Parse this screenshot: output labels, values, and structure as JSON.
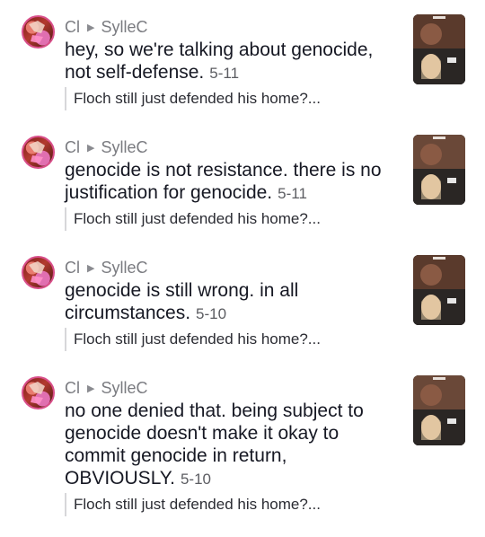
{
  "comments": [
    {
      "user": "Cl",
      "reply_to": "SylleC",
      "text": "hey, so we're talking about genocide, not self-defense.",
      "date": "5-11",
      "quote": "Floch still just defended his home?..."
    },
    {
      "user": "Cl",
      "reply_to": "SylleC",
      "text": "genocide is not resistance. there is no justification for genocide.",
      "date": "5-11",
      "quote": "Floch still just defended his home?..."
    },
    {
      "user": "Cl",
      "reply_to": "SylleC",
      "text": "genocide is still wrong. in all circumstances.",
      "date": "5-10",
      "quote": "Floch still just defended his home?..."
    },
    {
      "user": "Cl",
      "reply_to": "SylleC",
      "text": "no one denied that. being subject to genocide doesn't make it okay to commit genocide in return, OBVIOUSLY.",
      "date": "5-10",
      "quote": "Floch still just defended his home?..."
    }
  ],
  "icons": {
    "reply_arrow": "play-triangle-icon"
  },
  "colors": {
    "avatar_border": "#d94f8a",
    "muted_text": "#7a7b80",
    "quote_bar": "#d7d7da"
  }
}
